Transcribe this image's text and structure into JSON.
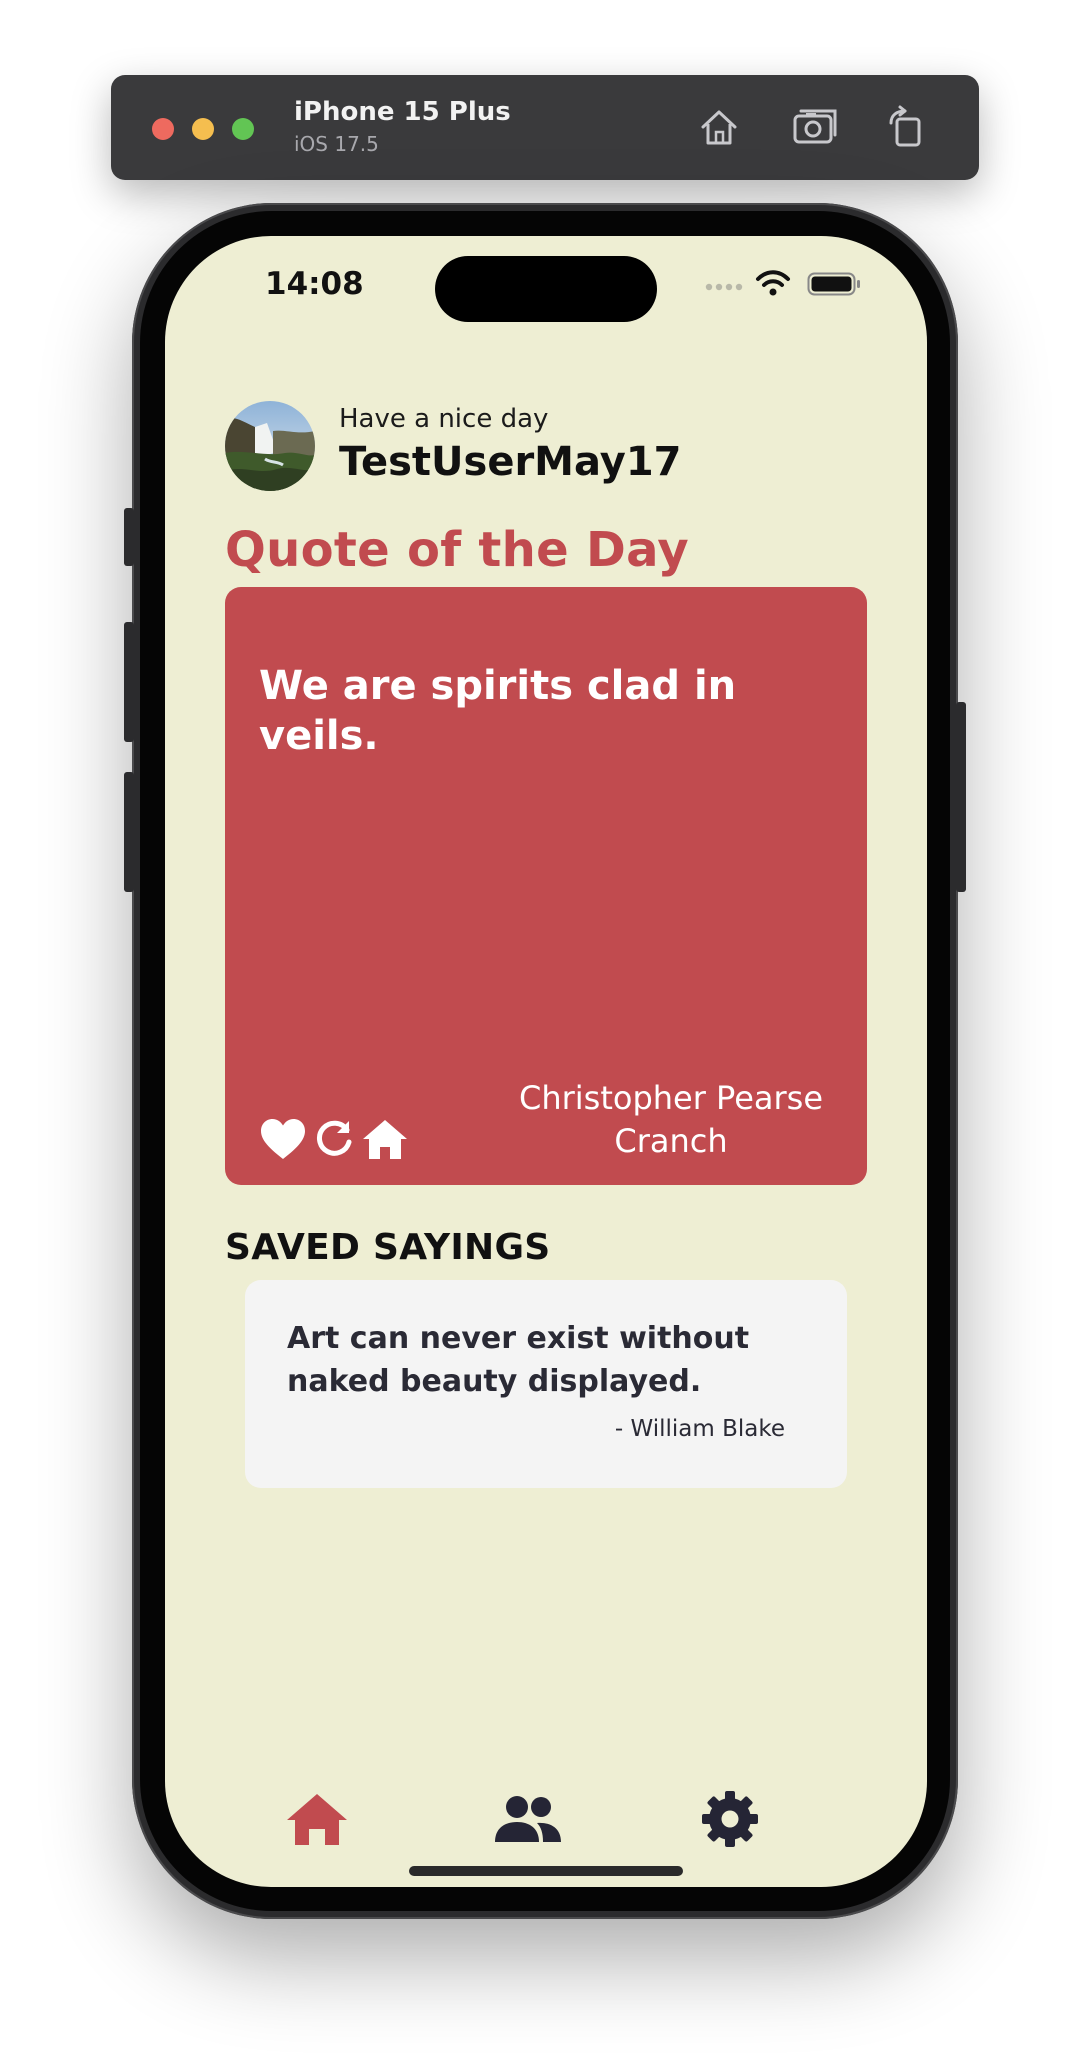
{
  "simulator": {
    "device_name": "iPhone 15 Plus",
    "os_version": "iOS 17.5",
    "icons": [
      "home-icon",
      "screenshot-icon",
      "rotate-icon"
    ]
  },
  "status_bar": {
    "time": "14:08"
  },
  "header": {
    "greeting": "Have a nice day",
    "username": "TestUserMay17"
  },
  "quote_of_the_day": {
    "heading": "Quote of the Day",
    "text": "We are spirits clad in veils.",
    "author": "Christopher Pearse Cranch",
    "actions": [
      "heart-icon",
      "refresh-icon",
      "home-icon"
    ]
  },
  "saved_sayings": {
    "heading": "SAVED SAYINGS",
    "items": [
      {
        "text": "Art can never exist without naked beauty displayed.",
        "author": "- William Blake"
      }
    ]
  },
  "bottom_nav": {
    "items": [
      "home-icon",
      "people-icon",
      "settings-icon"
    ],
    "active": "home-icon"
  },
  "colors": {
    "screen_background": "#eeeed3",
    "accent": "#c14b4f",
    "saved_card": "#f4f4f4",
    "text_dark": "#2a2a35"
  }
}
